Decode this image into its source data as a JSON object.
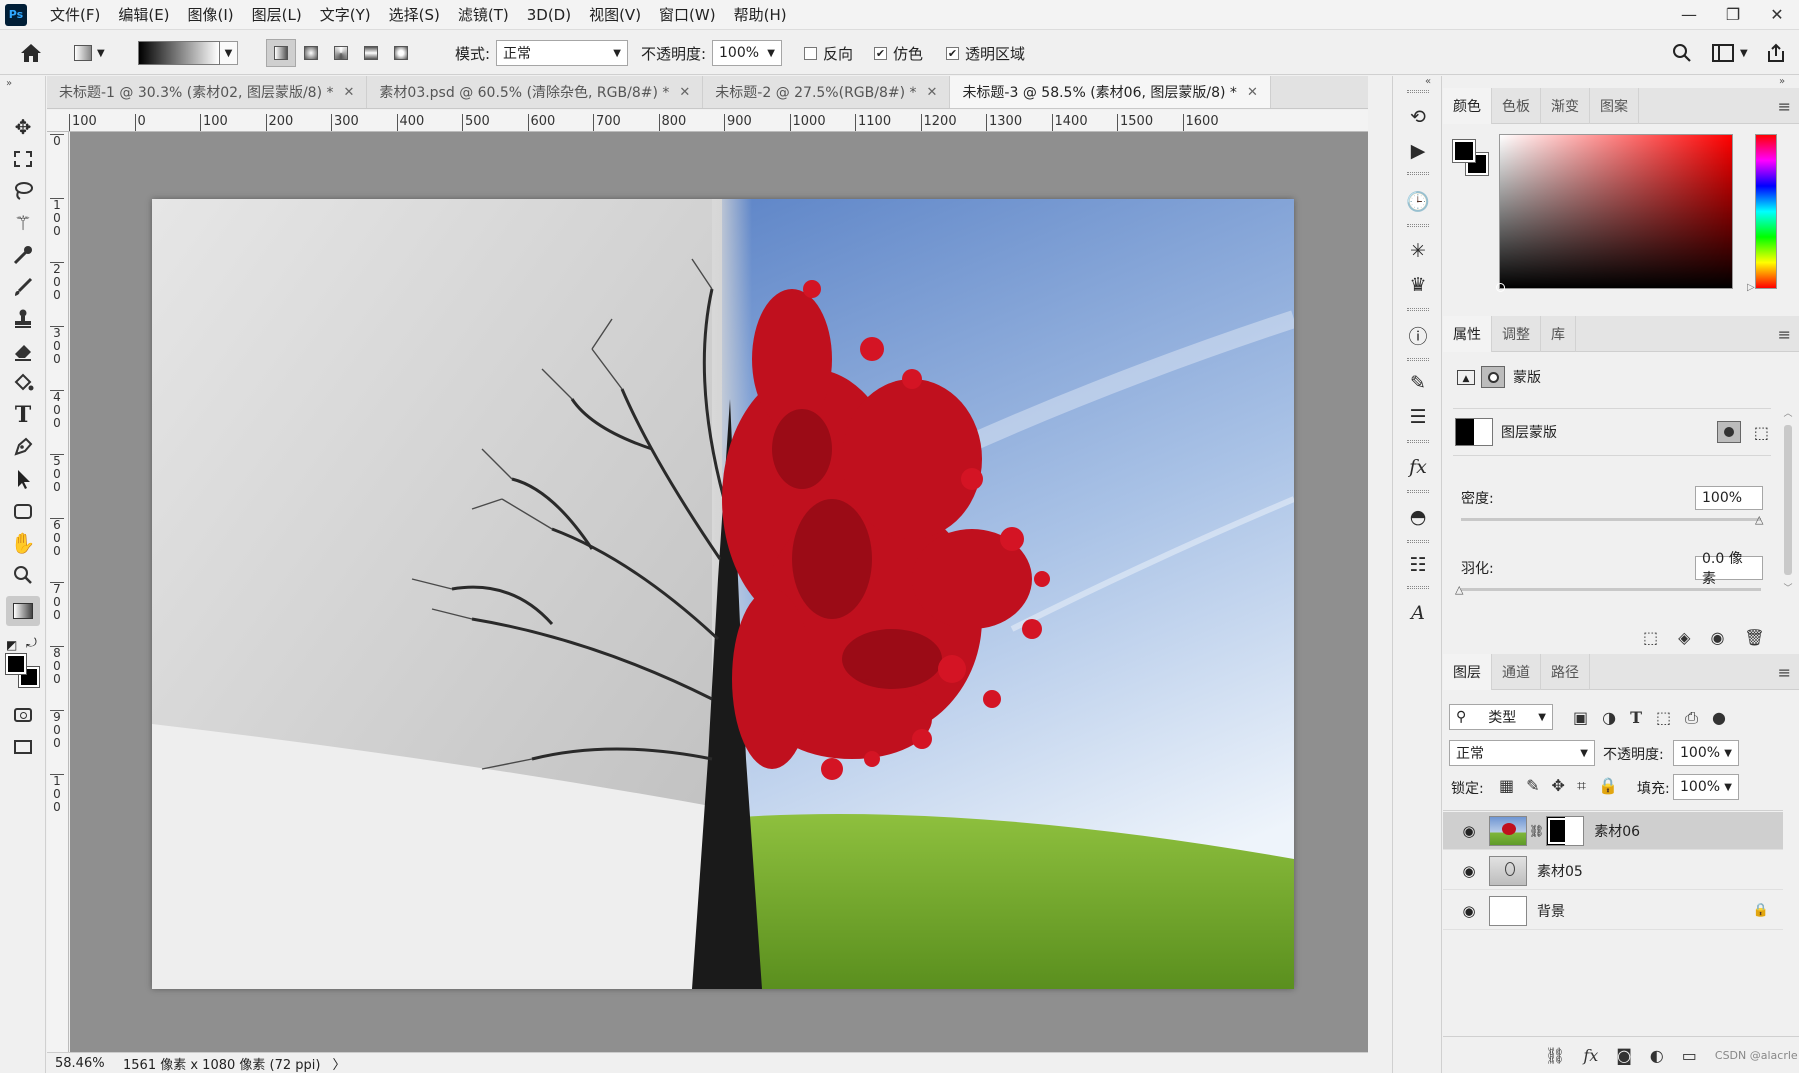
{
  "app": {
    "logo": "Ps",
    "menu": [
      "文件(F)",
      "编辑(E)",
      "图像(I)",
      "图层(L)",
      "文字(Y)",
      "选择(S)",
      "滤镜(T)",
      "3D(D)",
      "视图(V)",
      "窗口(W)",
      "帮助(H)"
    ],
    "window_controls": [
      "—",
      "❐",
      "✕"
    ]
  },
  "options": {
    "mode_label": "模式:",
    "mode_value": "正常",
    "opacity_label": "不透明度:",
    "opacity_value": "100%",
    "reverse_label": "反向",
    "dither_label": "仿色",
    "transparency_label": "透明区域"
  },
  "tabs": [
    {
      "label": "未标题-1 @ 30.3% (素材02, 图层蒙版/8) *",
      "active": false
    },
    {
      "label": "素材03.psd @ 60.5% (清除杂色, RGB/8#) *",
      "active": false
    },
    {
      "label": "未标题-2 @ 27.5%(RGB/8#) *",
      "active": false
    },
    {
      "label": "未标题-3 @ 58.5% (素材06, 图层蒙版/8) *",
      "active": true
    }
  ],
  "ruler": {
    "h_labels": [
      "100",
      "0",
      "100",
      "200",
      "300",
      "400",
      "500",
      "600",
      "700",
      "800",
      "900",
      "1000",
      "1100",
      "1200",
      "1300",
      "1400",
      "1500",
      "1600"
    ],
    "v_labels": [
      "0",
      "1 0 0",
      "2 0 0",
      "3 0 0",
      "4 0 0",
      "5 0 0",
      "6 0 0",
      "7 0 0",
      "8 0 0",
      "9 0 0",
      "1 0 0"
    ]
  },
  "status": {
    "zoom": "58.46%",
    "doc_info": "1561 像素 x 1080 像素 (72 ppi)",
    "arrow": "〉"
  },
  "color_panel": {
    "tabs": [
      "颜色",
      "色板",
      "渐变",
      "图案"
    ],
    "active_tab": "颜色",
    "hue": "#ff0000"
  },
  "properties_panel": {
    "tabs": [
      "属性",
      "调整",
      "库"
    ],
    "mask_title": "蒙版",
    "layer_mask_label": "图层蒙版",
    "density_label": "密度:",
    "density_value": "100%",
    "density_fraction": 1.0,
    "feather_label": "羽化:",
    "feather_value": "0.0 像素",
    "feather_fraction": 0.0
  },
  "layers_panel": {
    "tabs": [
      "图层",
      "通道",
      "路径"
    ],
    "filter_label": "类型",
    "blend_mode": "正常",
    "opacity_label": "不透明度:",
    "opacity_value": "100%",
    "lock_label": "锁定:",
    "fill_label": "填充:",
    "fill_value": "100%",
    "layers": [
      {
        "name": "素材06",
        "selected": true,
        "has_mask": true,
        "locked": false
      },
      {
        "name": "素材05",
        "selected": false,
        "has_mask": false,
        "locked": false
      },
      {
        "name": "背景",
        "selected": false,
        "has_mask": false,
        "locked": true
      }
    ]
  },
  "watermark": "CSDN @alacrle"
}
